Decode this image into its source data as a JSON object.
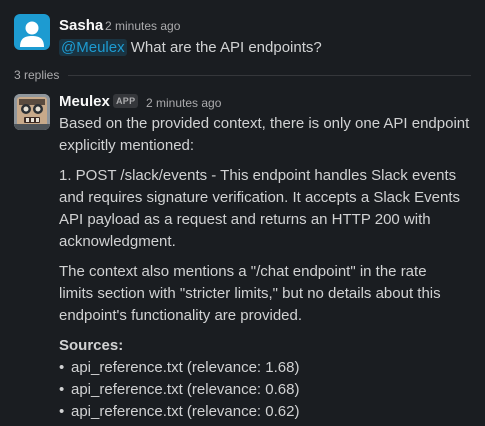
{
  "messages": [
    {
      "sender": "Sasha",
      "time": "2 minutes ago",
      "mention": "@Meulex",
      "text": "What are the API endpoints?",
      "avatar_icon": "user-silhouette-icon",
      "avatar_color": "#1d9bd1"
    }
  ],
  "thread": {
    "replies_label": "3 replies"
  },
  "reply": {
    "sender": "Meulex",
    "badge": "APP",
    "time": "2 minutes ago",
    "avatar_icon": "robot-avatar-icon",
    "paragraph1": "Based on the provided context, there is only one API endpoint explicitly mentioned:",
    "paragraph2": "1. POST /slack/events - This endpoint handles Slack events and requires signature verification. It accepts a Slack Events API payload as a request and returns an HTTP 200 with acknowledgment.",
    "paragraph3": "The context also mentions a \"/chat endpoint\" in the rate limits section with \"stricter limits,\" but no details about this endpoint's functionality are provided.",
    "sources_title": "Sources:",
    "sources": [
      "api_reference.txt (relevance: 1.68)",
      "api_reference.txt (relevance: 0.68)",
      "api_reference.txt (relevance: 0.62)"
    ]
  }
}
